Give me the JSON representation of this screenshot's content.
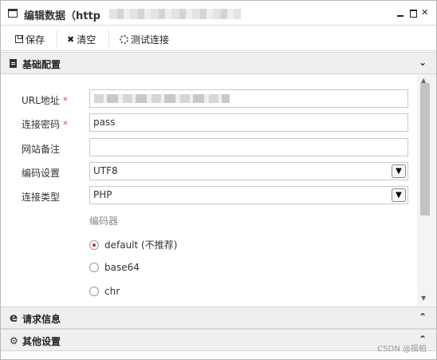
{
  "window": {
    "title": "编辑数据（http",
    "minimize_label": "",
    "maximize_label": "",
    "close_label": ""
  },
  "toolbar": {
    "save_label": "保存",
    "clear_label": "清空",
    "test_label": "测试连接"
  },
  "sections": {
    "basic": {
      "label": "基础配置",
      "chevron": "⌄",
      "expanded": true
    },
    "request": {
      "label": "请求信息",
      "chevron": "⌃",
      "expanded": false
    },
    "other": {
      "label": "其他设置",
      "chevron": "⌃",
      "expanded": false
    }
  },
  "form": {
    "url_label": "URL地址",
    "url_required": "*",
    "password_label": "连接密码",
    "password_required": "*",
    "password_value": "pass",
    "note_label": "网站备注",
    "note_value": "",
    "encoding_label": "编码设置",
    "encoding_value": "UTF8",
    "type_label": "连接类型",
    "type_value": "PHP",
    "encoder_title": "编码器",
    "encoders": [
      {
        "label": "default (不推荐)",
        "checked": true
      },
      {
        "label": "base64",
        "checked": false
      },
      {
        "label": "chr",
        "checked": false
      }
    ]
  },
  "watermark": "CSDN @摇柏",
  "colors": {
    "required": "#d9534f",
    "section_bg": "#efefef",
    "radio_checked": "#c0392b"
  }
}
